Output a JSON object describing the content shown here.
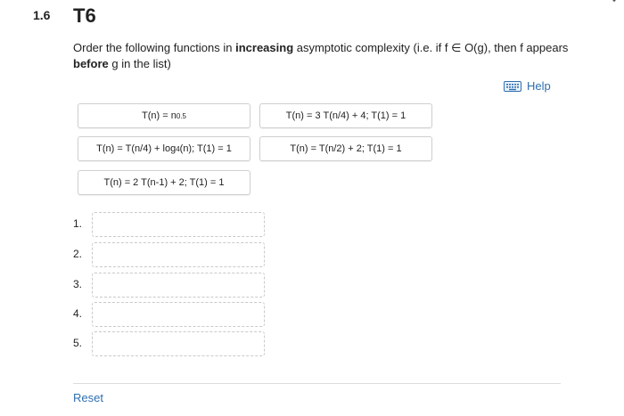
{
  "question": {
    "number": "1.6",
    "title": "T6"
  },
  "instructions": {
    "part1": "Order the following functions in ",
    "bold1": "increasing",
    "part2": " asymptotic complexity (i.e. if f ∈ O(g), then f appears ",
    "bold2": "before",
    "part3": " g in the list)"
  },
  "help": {
    "label": "Help",
    "icon": "keyboard-icon"
  },
  "tiles": [
    {
      "base": "T(n) = n",
      "sup": "0.5"
    },
    {
      "text": "T(n) = 3 T(n/4) + 4; T(1) = 1"
    },
    {
      "pre": "T(n) = T(n/4)  + log",
      "sub": "4",
      "post": "(n); T(1) = 1"
    },
    {
      "text": "T(n) = T(n/2) + 2; T(1) = 1"
    },
    {
      "text": "T(n) = 2 T(n-1) + 2; T(1) = 1"
    }
  ],
  "slots": [
    "1.",
    "2.",
    "3.",
    "4.",
    "5."
  ],
  "reset_label": "Reset",
  "colors": {
    "link": "#2e6fb0",
    "tile_border": "#cfcfcf",
    "slot_border": "#c9c9c9"
  }
}
